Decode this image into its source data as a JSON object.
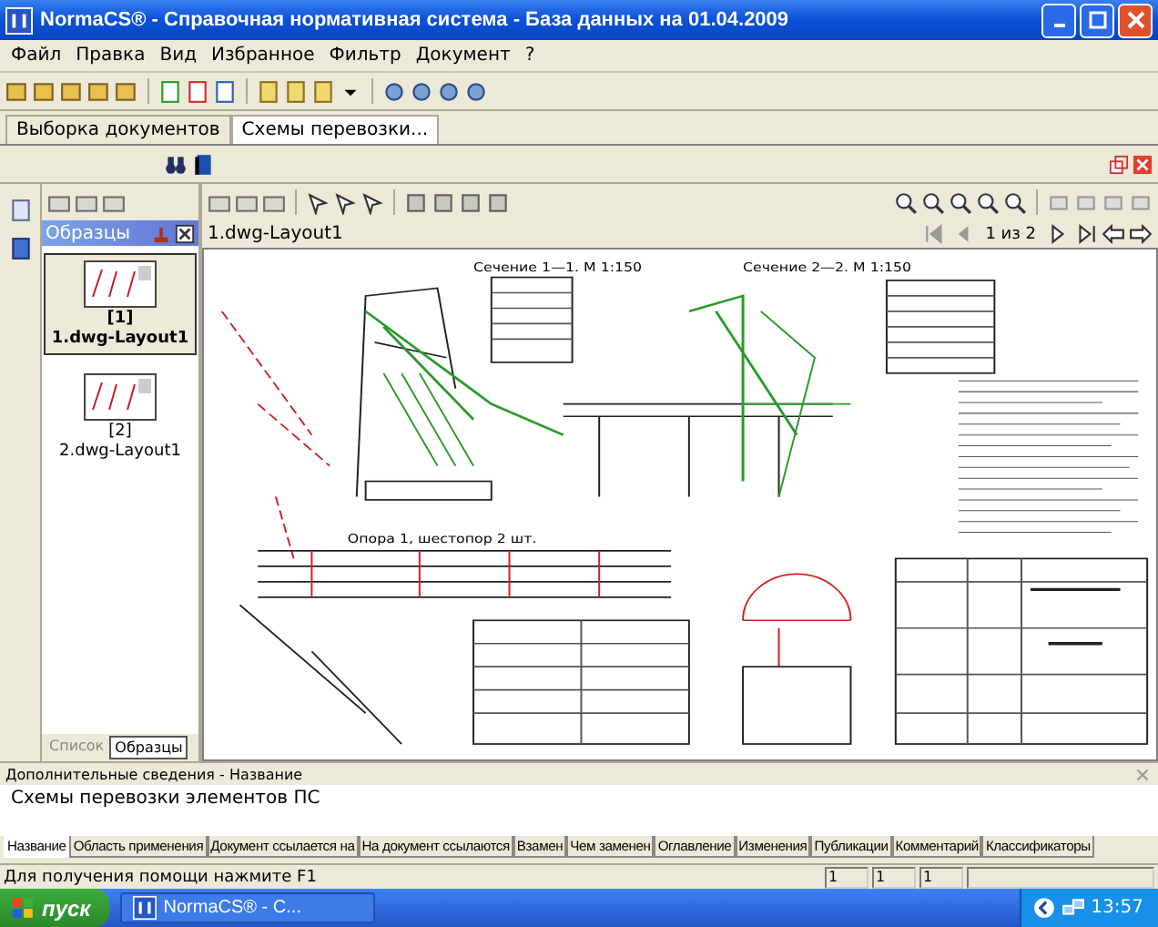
{
  "window": {
    "title": "NormaCS® - Справочная нормативная система - База данных на 01.04.2009"
  },
  "menu": [
    "Файл",
    "Правка",
    "Вид",
    "Избранное",
    "Фильтр",
    "Документ",
    "?"
  ],
  "document_tabs": [
    {
      "label": "Выборка документов",
      "selected": false
    },
    {
      "label": "Схемы перевозки...",
      "selected": true
    }
  ],
  "panel": {
    "title": "Образцы",
    "thumbnails": [
      {
        "number": "[1]",
        "label": "1.dwg-Layout1",
        "selected": true
      },
      {
        "number": "[2]",
        "label": "2.dwg-Layout1",
        "selected": false
      }
    ],
    "tabs": [
      {
        "label": "Список",
        "selected": false
      },
      {
        "label": "Образцы",
        "selected": true
      }
    ]
  },
  "viewer": {
    "tab_label": "1.dwg-Layout1",
    "page_indicator": "1 из 2",
    "drawing_labels": [
      "Сечение 1—1. М 1:150",
      "Сечение 2—2. М 1:150",
      "Опора 1, шестопор 2 шт."
    ]
  },
  "details": {
    "title": "Дополнительные сведения - Название",
    "text": "Схемы перевозки элементов ПС",
    "tabs": [
      {
        "label": "Название",
        "selected": true
      },
      {
        "label": "Область применения",
        "selected": false
      },
      {
        "label": "Документ ссылается на",
        "selected": false
      },
      {
        "label": "На документ ссылаются",
        "selected": false
      },
      {
        "label": "Взамен",
        "selected": false
      },
      {
        "label": "Чем заменен",
        "selected": false
      },
      {
        "label": "Оглавление",
        "selected": false
      },
      {
        "label": "Изменения",
        "selected": false
      },
      {
        "label": "Публикации",
        "selected": false
      },
      {
        "label": "Комментарий",
        "selected": false
      },
      {
        "label": "Классификаторы",
        "selected": false
      }
    ]
  },
  "status_bar": {
    "help": "Для получения помощи нажмите F1",
    "fields": [
      "1",
      "1",
      "1"
    ]
  },
  "taskbar": {
    "start": "пуск",
    "task": "NormaCS® - C...",
    "clock": "13:57"
  }
}
